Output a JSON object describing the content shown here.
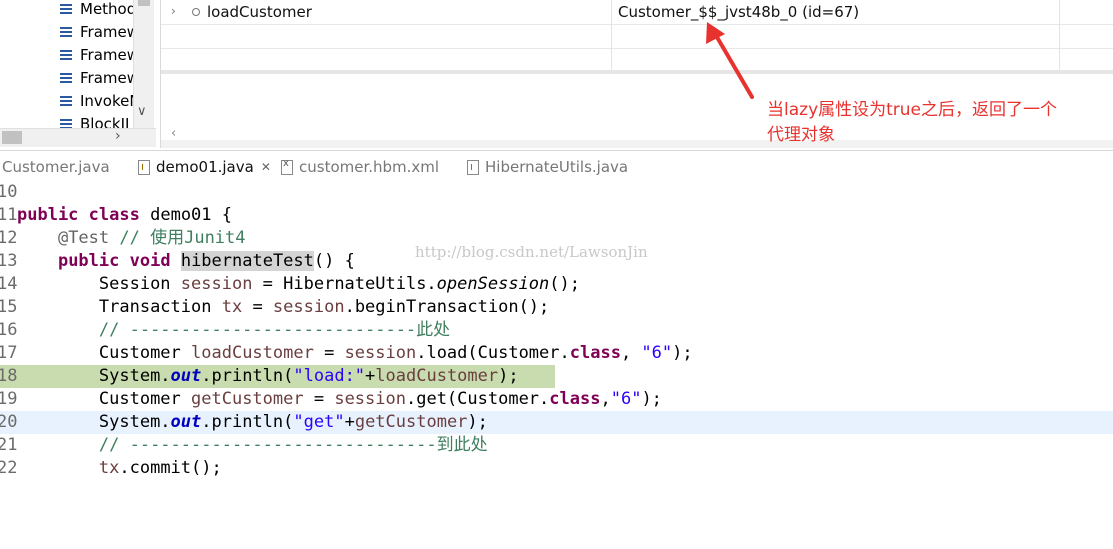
{
  "outline": {
    "items": [
      "Method",
      "Framew",
      "Framew",
      "Framew",
      "InvokeN",
      "BlockJI"
    ]
  },
  "variables": {
    "row_name": "loadCustomer",
    "row_value": "Customer_$$_jvst48b_0  (id=67)"
  },
  "annotation": {
    "line1": "当lazy属性设为true之后，返回了一个",
    "line2": "代理对象",
    "color": "#e8322e"
  },
  "tabs": [
    {
      "label": "Customer.java",
      "icon": "java-file-icon",
      "active": false
    },
    {
      "label": "demo01.java",
      "icon": "java-file-icon",
      "active": true,
      "close": "✕"
    },
    {
      "label": "customer.hbm.xml",
      "icon": "xml-file-icon",
      "active": false
    },
    {
      "label": "HibernateUtils.java",
      "icon": "java-file-icon",
      "active": false
    }
  ],
  "editor": {
    "line_numbers": [
      "10",
      "11",
      "12",
      "13",
      "14",
      "15",
      "16",
      "17",
      "18",
      "19",
      "20",
      "21",
      "22"
    ],
    "tokens": {
      "public": "public",
      "class": "class",
      "void": "void",
      "class_name": "demo01",
      "brace_open": " {",
      "annotation": "@Test",
      "comment_junit": "// 使用Junit4",
      "method": "hibernateTest",
      "method_tail": "() {",
      "session_type": "Session ",
      "session_var": "session",
      "open_session_pre": " = HibernateUtils.",
      "open_session": "openSession",
      "open_session_post": "();",
      "tx_type": "Transaction ",
      "tx_var": "tx",
      "tx_eq": " = ",
      "begin_tx": ".beginTransaction();",
      "comment_here": "// ----------------------------此处",
      "customer_type": "Customer ",
      "load_var": "loadCustomer",
      "load_call": ".load(Customer.",
      "load_args_sep": ", ",
      "load_arg": "\"6\"",
      "close_paren": ");",
      "system": "System.",
      "out": "out",
      "println": ".println(",
      "str_load": "\"load:\"",
      "plus": "+",
      "get_var": "getCustomer",
      "get_call": ".get(Customer.",
      "get_args_sep": ",",
      "get_arg": "\"6\"",
      "str_get": "\"get\"",
      "comment_till": "// ------------------------------到此处",
      "commit": ".commit();"
    },
    "breakpoint_line": "18",
    "current_line": "20",
    "highlight_colors": {
      "breakpoint": "#c9dcaf",
      "current": "#e8f2fe"
    }
  },
  "watermark": "http://blog.csdn.net/LawsonJin"
}
